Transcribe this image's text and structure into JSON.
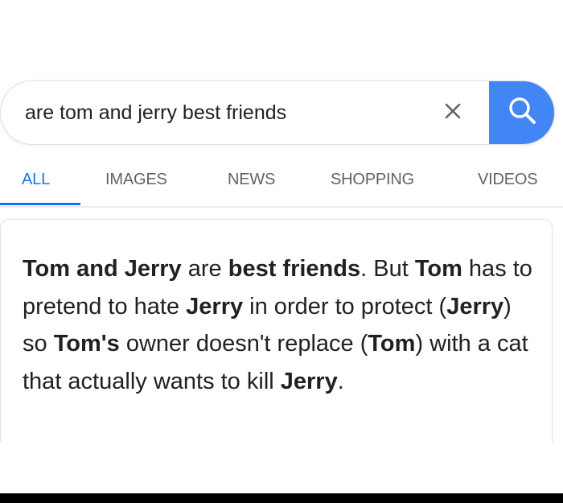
{
  "search": {
    "query": "are tom and jerry best friends",
    "clear_icon": "close-icon",
    "search_icon": "magnifier-icon",
    "accent_color": "#4285f4"
  },
  "tabs": [
    {
      "label": "ALL",
      "active": true
    },
    {
      "label": "IMAGES",
      "active": false
    },
    {
      "label": "NEWS",
      "active": false
    },
    {
      "label": "SHOPPING",
      "active": false
    },
    {
      "label": "VIDEOS",
      "active": false
    }
  ],
  "answer": {
    "segments": [
      {
        "text": "Tom and Jerry",
        "bold": true
      },
      {
        "text": " are ",
        "bold": false
      },
      {
        "text": "best friends",
        "bold": true
      },
      {
        "text": ". But ",
        "bold": false
      },
      {
        "text": "Tom",
        "bold": true
      },
      {
        "text": " has to pretend to hate ",
        "bold": false
      },
      {
        "text": "Jerry",
        "bold": true
      },
      {
        "text": " in order to protect (",
        "bold": false
      },
      {
        "text": "Jerry",
        "bold": true
      },
      {
        "text": ") so ",
        "bold": false
      },
      {
        "text": "Tom's",
        "bold": true
      },
      {
        "text": " owner doesn't replace (",
        "bold": false
      },
      {
        "text": "Tom",
        "bold": true
      },
      {
        "text": ") with a cat that actually wants to kill ",
        "bold": false
      },
      {
        "text": "Jerry",
        "bold": true
      },
      {
        "text": ".",
        "bold": false
      }
    ]
  }
}
